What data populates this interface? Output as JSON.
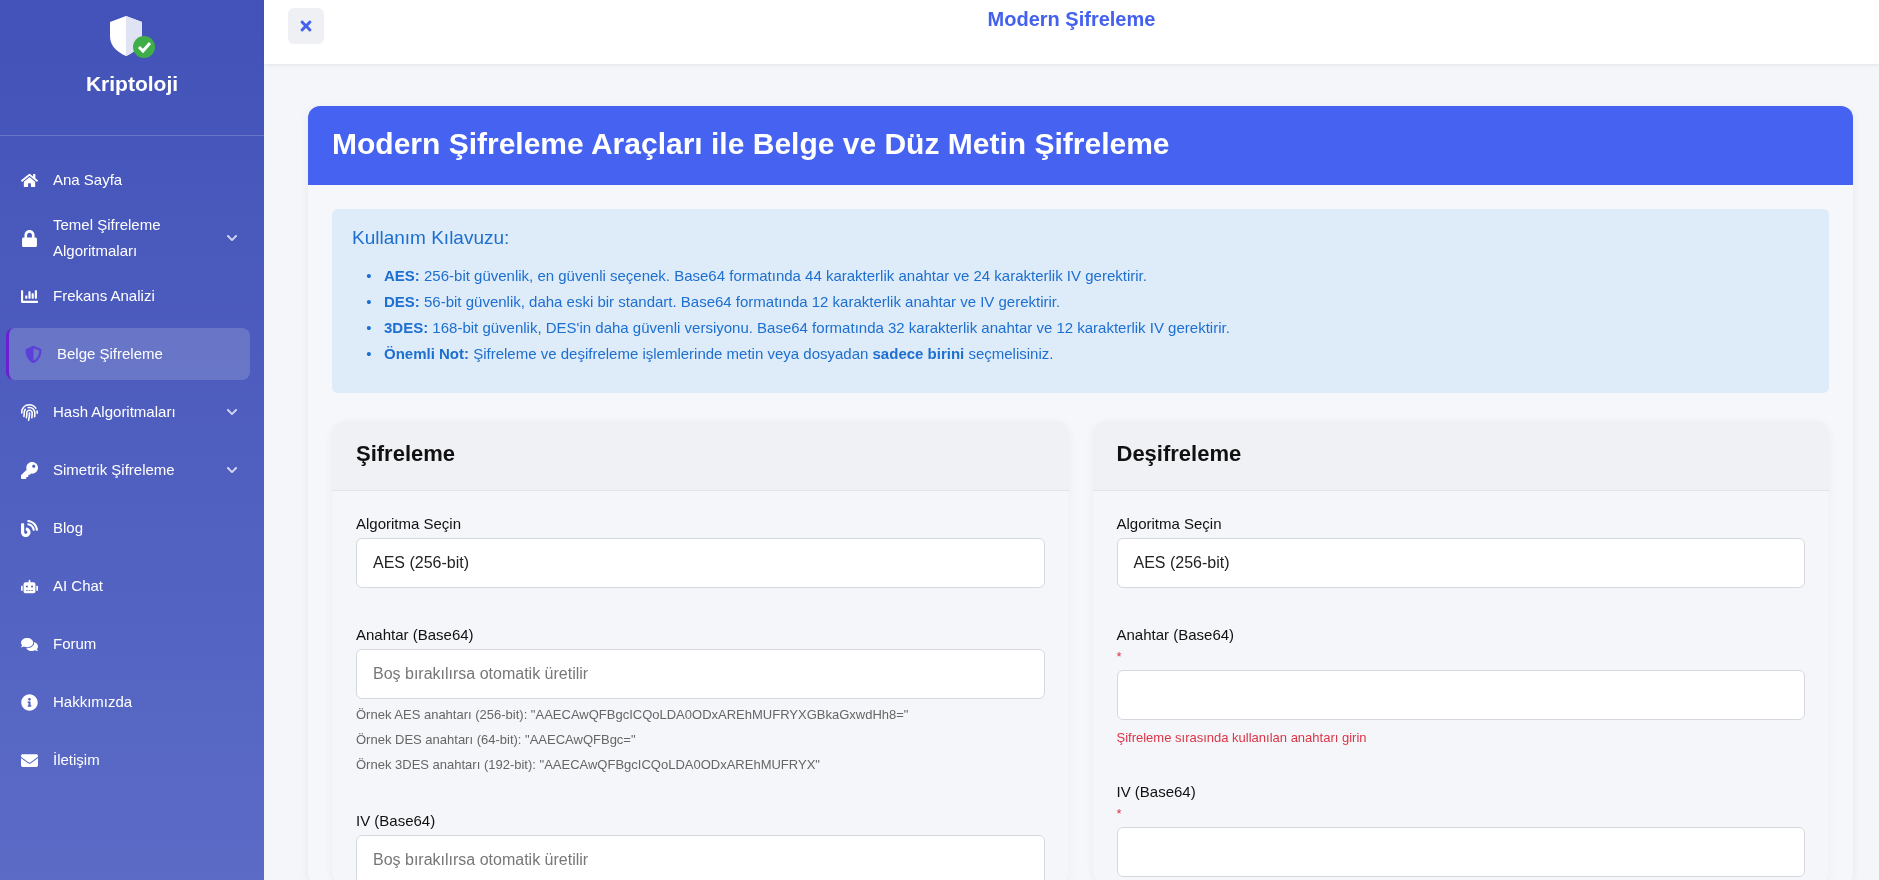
{
  "sidebar": {
    "brand": "Kriptoloji",
    "items": [
      {
        "label": "Ana Sayfa",
        "selected": false,
        "has_submenu": false
      },
      {
        "label": "Temel Şifreleme Algoritmaları",
        "selected": false,
        "has_submenu": true
      },
      {
        "label": "Frekans Analizi",
        "selected": false,
        "has_submenu": false
      },
      {
        "label": "Belge Şifreleme",
        "selected": true,
        "has_submenu": false
      },
      {
        "label": "Hash Algoritmaları",
        "selected": false,
        "has_submenu": true
      },
      {
        "label": "Simetrik Şifreleme",
        "selected": false,
        "has_submenu": true
      },
      {
        "label": "Blog",
        "selected": false,
        "has_submenu": false
      },
      {
        "label": "AI Chat",
        "selected": false,
        "has_submenu": false
      },
      {
        "label": "Forum",
        "selected": false,
        "has_submenu": false
      },
      {
        "label": "Hakkımızda",
        "selected": false,
        "has_submenu": false
      },
      {
        "label": "İletişim",
        "selected": false,
        "has_submenu": false
      }
    ]
  },
  "topbar": {
    "title": "Modern Şifreleme"
  },
  "card": {
    "title": "Modern Şifreleme Araçları ile Belge ve Düz Metin Şifreleme",
    "guide": {
      "title": "Kullanım Kılavuzu:",
      "items": [
        {
          "marker": "•",
          "text": "**AES:** 256-bit güvenlik, en güvenli seçenek. Base64 formatında 44 karakterlik anahtar ve 24 karakterlik IV gerektirir."
        },
        {
          "marker": "•",
          "text": "**DES:** 56-bit güvenlik, daha eski bir standart. Base64 formatında 12 karakterlik anahtar ve IV gerektirir."
        },
        {
          "marker": "•",
          "text": "**3DES:** 168-bit güvenlik, DES'in daha güvenli versiyonu. Base64 formatında 32 karakterlik anahtar ve 12 karakterlik IV gerektirir."
        },
        {
          "marker": "•",
          "text": "**Önemli Not:** Şifreleme ve deşifreleme işlemlerinde metin veya dosyadan **sadece birini** seçmelisiniz."
        }
      ]
    },
    "panels": [
      {
        "title": "Şifreleme",
        "fields": [
          {
            "kind": "select",
            "label": "Algoritma Seçin",
            "value": "AES (256-bit)"
          },
          {
            "kind": "input",
            "label": "Anahtar (Base64)",
            "placeholder": "Boş bırakılırsa otomatik üretilir",
            "hints": [
              "Örnek AES anahtarı (256-bit): \"AAECAwQFBgcICQoLDA0ODxAREhMUFRYXGBkaGxwdHh8=\"",
              "Örnek DES anahtarı (64-bit): \"AAECAwQFBgc=\"",
              "Örnek 3DES anahtarı (192-bit): \"AAECAwQFBgcICQoLDA0ODxAREhMUFRYX\""
            ]
          },
          {
            "kind": "input",
            "label": "IV (Base64)",
            "placeholder": "Boş bırakılırsa otomatik üretilir"
          }
        ]
      },
      {
        "title": "Deşifreleme",
        "fields": [
          {
            "kind": "select",
            "label": "Algoritma Seçin",
            "value": "AES (256-bit)"
          },
          {
            "kind": "input",
            "label": "Anahtar (Base64)",
            "required_mark": "*",
            "error": "Şifreleme sırasında kullanılan anahtarı girin"
          },
          {
            "kind": "input",
            "label": "IV (Base64)",
            "required_mark": "*"
          }
        ]
      }
    ]
  }
}
